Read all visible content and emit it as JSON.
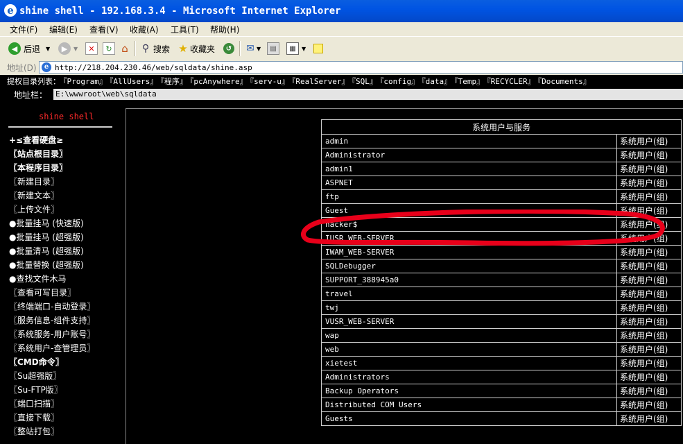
{
  "window": {
    "title": "shine shell - 192.168.3.4 - Microsoft Internet Explorer"
  },
  "menu": [
    "文件(F)",
    "编辑(E)",
    "查看(V)",
    "收藏(A)",
    "工具(T)",
    "帮助(H)"
  ],
  "toolbar": {
    "back": "后退",
    "search": "搜索",
    "favorites": "收藏夹"
  },
  "address": {
    "label": "地址(D)",
    "url": "http://218.204.230.46/web/sqldata/shine.asp"
  },
  "page": {
    "dir_label": "提权目录列表：",
    "dirs": [
      "『Program』",
      "『AllUsers』",
      "『程序』",
      "『pcAnywhere』",
      "『serv-u』",
      "『RealServer』",
      "『SQL』",
      "『config』",
      "『data』",
      "『Temp』",
      "『RECYCLER』",
      "『Documents』"
    ],
    "path_label": "地址栏：",
    "path_value": "E:\\wwwroot\\web\\sqldata",
    "brand": "shine shell",
    "nav": [
      {
        "label": "+≤查看硬盘≥",
        "bold": true
      },
      {
        "label": "〖站点根目录〗",
        "bold": true
      },
      {
        "label": "〖本程序目录〗",
        "bold": true
      },
      {
        "label": "〖新建目录〗",
        "bold": false
      },
      {
        "label": "〖新建文本〗",
        "bold": false
      },
      {
        "label": "〖上传文件〗",
        "bold": false
      },
      {
        "label": "●批量挂马 (快速版)",
        "bold": false
      },
      {
        "label": "●批量挂马 (超强版)",
        "bold": false
      },
      {
        "label": "●批量清马 (超强版)",
        "bold": false
      },
      {
        "label": "●批量替换 (超强版)",
        "bold": false
      },
      {
        "label": "●查找文件木马",
        "bold": false
      },
      {
        "label": "〖查看可写目录〗",
        "bold": false
      },
      {
        "label": "〖终端端口-自动登录〗",
        "bold": false
      },
      {
        "label": "〖服务信息-组件支持〗",
        "bold": false
      },
      {
        "label": "〖系统服务-用户账号〗",
        "bold": false
      },
      {
        "label": "〖系统用户-查管理员〗",
        "bold": false
      },
      {
        "label": "〖CMD命令〗",
        "bold": true
      },
      {
        "label": "〖Su超强版〗",
        "bold": false
      },
      {
        "label": "〖Su-FTP版〗",
        "bold": false
      },
      {
        "label": "〖端口扫描〗",
        "bold": false
      },
      {
        "label": "〖直接下载〗",
        "bold": false
      },
      {
        "label": "〖整站打包〗",
        "bold": false
      }
    ],
    "table": {
      "header": "系统用户与服务",
      "kind_label": "系统用户(组)",
      "rows": [
        "admin",
        "Administrator",
        "admin1",
        "ASPNET",
        "ftp",
        "Guest",
        "hacker$",
        "IUSR_WEB-SERVER",
        "IWAM_WEB-SERVER",
        "SQLDebugger",
        "SUPPORT_388945a0",
        "travel",
        "twj",
        "VUSR_WEB-SERVER",
        "wap",
        "web",
        "xietest",
        "Administrators",
        "Backup Operators",
        "Distributed COM Users",
        "Guests"
      ]
    },
    "highlight_color": "#e8001a"
  }
}
